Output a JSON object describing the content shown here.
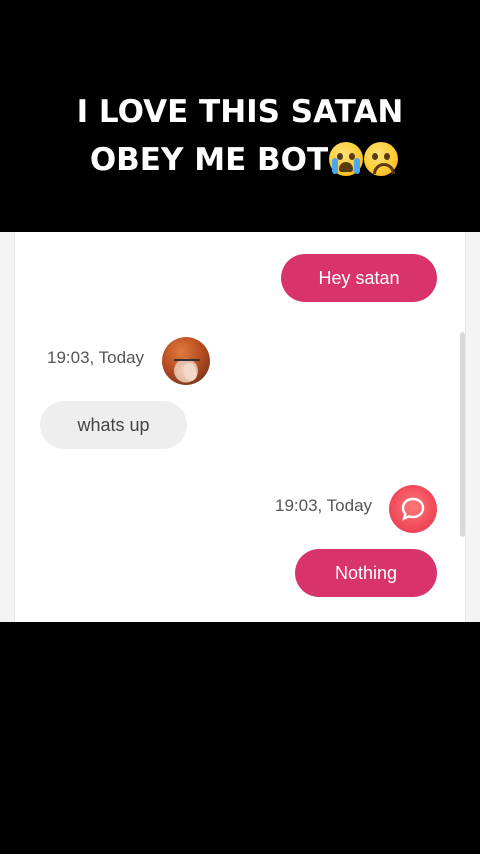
{
  "caption": {
    "line1": "I LOVE THIS SATAN",
    "line2": "OBEY ME BOT",
    "emojis": [
      "loudly-crying-face",
      "frowning-face"
    ]
  },
  "chat": {
    "messages": [
      {
        "id": "m1",
        "direction": "outgoing",
        "text": "Hey satan"
      },
      {
        "id": "m2",
        "direction": "incoming",
        "time": "19:03, Today",
        "text": "whats up",
        "avatar": "satan-avatar"
      },
      {
        "id": "m3",
        "direction": "outgoing",
        "time": "19:03, Today",
        "text": "Nothing",
        "avatar": "chat-bubble-icon"
      }
    ]
  },
  "colors": {
    "background": "#000000",
    "outgoing_bubble": "#d8336a",
    "incoming_bubble": "#eeeeee",
    "app_icon": "#f04a5a"
  }
}
